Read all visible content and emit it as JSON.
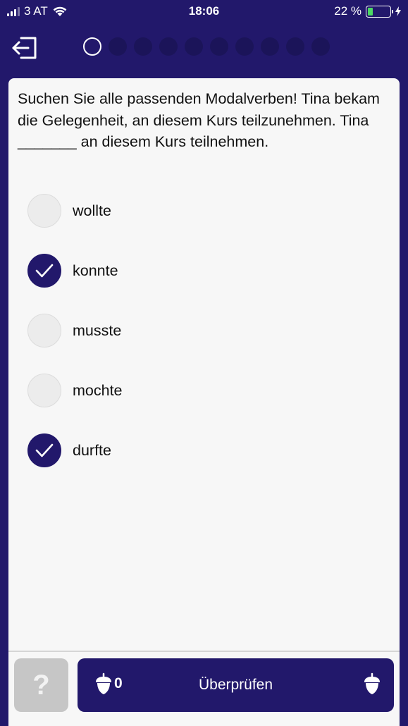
{
  "status_bar": {
    "carrier": "3 AT",
    "time": "18:06",
    "battery_percent": "22 %",
    "battery_level": 0.22
  },
  "header": {
    "progress_total": 10,
    "progress_current": 1
  },
  "question": {
    "text": "Suchen Sie alle passenden Modalverben! Tina bekam die Gelegenheit, an diesem Kurs teilzunehmen. Tina _______ an diesem Kurs teilnehmen."
  },
  "options": [
    {
      "label": "wollte",
      "checked": false
    },
    {
      "label": "konnte",
      "checked": true
    },
    {
      "label": "musste",
      "checked": false
    },
    {
      "label": "mochte",
      "checked": false
    },
    {
      "label": "durfte",
      "checked": true
    }
  ],
  "footer": {
    "help_label": "?",
    "check_label": "Überprüfen",
    "acorn_count": "0"
  },
  "colors": {
    "brand": "#22186b",
    "card": "#f7f7f7",
    "battery": "#4cd964"
  },
  "icons": {
    "exit": "exit-arrow-icon",
    "acorn": "acorn-icon",
    "check": "checkmark-icon"
  }
}
